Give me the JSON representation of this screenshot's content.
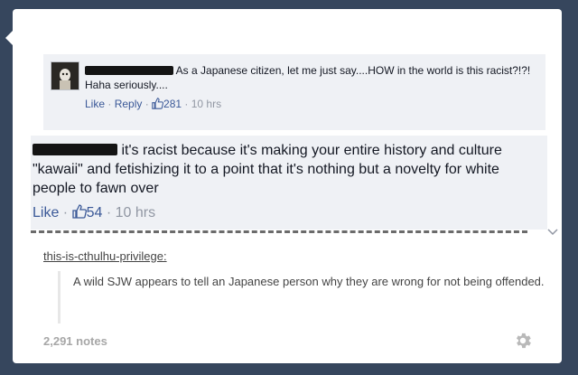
{
  "comment_1": {
    "text": "As a Japanese citizen, let me just say....HOW in the world is this racist?!?! Haha seriously....",
    "like_label": "Like",
    "reply_label": "Reply",
    "separator": " · ",
    "like_count": "281",
    "time": "10 hrs"
  },
  "comment_2": {
    "text": "it's racist because it's making your entire history and culture \"kawaii\" and fetishizing it to a point that it's nothing but a novelty for white people to fawn over",
    "like_label": "Like",
    "separator": " · ",
    "like_count": "54",
    "time": "10 hrs"
  },
  "reblog": {
    "username": "this-is-cthulhu-privilege",
    "colon": ":",
    "quote": "A wild SJW appears to tell an Japanese person why they are wrong for not being offended."
  },
  "footer": {
    "notes": "2,291 notes"
  },
  "icons": {
    "avatar": "profile-photo",
    "thumb": "thumbs-up-icon",
    "settings": "gear-icon",
    "chevron": "chevron-down-icon"
  },
  "colors": {
    "dashboard_bg": "#36465d",
    "comment_bg": "#eff1f5",
    "link_blue": "#3b5998",
    "meta_gray": "#9197a3"
  }
}
